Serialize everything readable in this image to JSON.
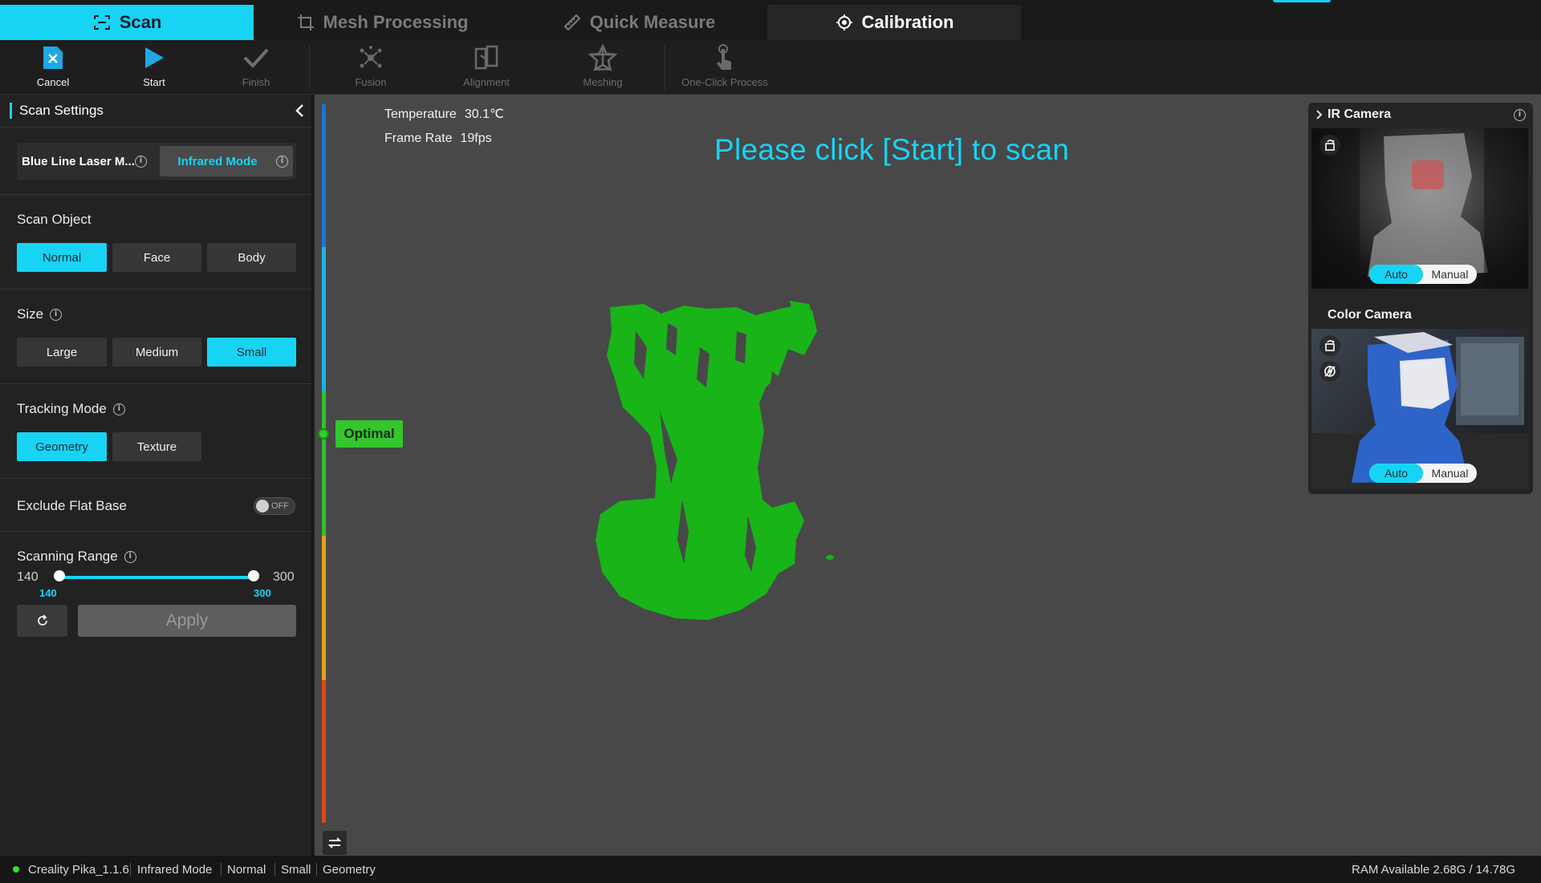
{
  "tabs": [
    {
      "label": "Scan",
      "icon": "scan-frame-icon",
      "state": "active"
    },
    {
      "label": "Mesh Processing",
      "icon": "crop-icon",
      "state": "inactive"
    },
    {
      "label": "Quick Measure",
      "icon": "ruler-icon",
      "state": "inactive"
    },
    {
      "label": "Calibration",
      "icon": "crosshair-icon",
      "state": "highlight"
    }
  ],
  "toolbar": {
    "cancel": "Cancel",
    "start": "Start",
    "finish": "Finish",
    "fusion": "Fusion",
    "alignment": "Alignment",
    "meshing": "Meshing",
    "one_click": "One-Click Process"
  },
  "settings": {
    "title": "Scan Settings",
    "modes": {
      "laser": "Blue Line Laser M...",
      "infrared": "Infrared Mode",
      "selected": "Infrared Mode"
    },
    "scan_object": {
      "label": "Scan Object",
      "options": [
        "Normal",
        "Face",
        "Body"
      ],
      "selected": "Normal"
    },
    "size": {
      "label": "Size",
      "options": [
        "Large",
        "Medium",
        "Small"
      ],
      "selected": "Small"
    },
    "tracking": {
      "label": "Tracking Mode",
      "options": [
        "Geometry",
        "Texture"
      ],
      "selected": "Geometry"
    },
    "exclude_flat_base": {
      "label": "Exclude Flat Base",
      "state": "OFF"
    },
    "scanning_range": {
      "label": "Scanning Range",
      "min": "140",
      "max": "300",
      "low_value": "140",
      "high_value": "300"
    },
    "apply": "Apply"
  },
  "viewport": {
    "temperature_label": "Temperature",
    "temperature_value": "30.1℃",
    "framerate_label": "Frame Rate",
    "framerate_value": "19fps",
    "prompt": "Please click [Start] to scan",
    "distance_indicator": "Optimal",
    "point_cloud_color": "#18b418"
  },
  "cameras": {
    "ir": {
      "title": "IR Camera",
      "auto": "Auto",
      "manual": "Manual",
      "selected": "Auto"
    },
    "color": {
      "title": "Color Camera",
      "auto": "Auto",
      "manual": "Manual",
      "selected": "Auto"
    }
  },
  "status": {
    "app": "Creality Pika_1.1.6",
    "mode": "Infrared Mode",
    "object": "Normal",
    "size": "Small",
    "tracking": "Geometry",
    "ram": "RAM Available 2.68G / 14.78G"
  },
  "colors": {
    "accent": "#17d4f5",
    "optimal": "#35c52f"
  }
}
